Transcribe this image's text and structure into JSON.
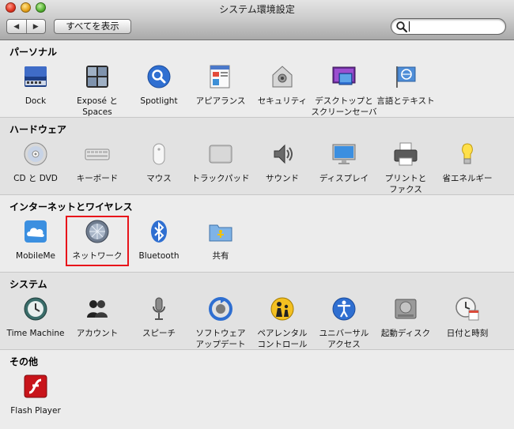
{
  "window": {
    "title": "システム環境設定"
  },
  "toolbar": {
    "back_glyph": "◀",
    "forward_glyph": "▶",
    "show_all_label": "すべてを表示",
    "search_value": "",
    "search_placeholder": ""
  },
  "colors": {
    "highlight": "#e8141a",
    "accent": "#2f6fd1"
  },
  "sections": [
    {
      "title": "パーソナル",
      "items": [
        {
          "label": "Dock",
          "icon": "dock-icon"
        },
        {
          "label": "Exposé と\nSpaces",
          "icon": "expose-spaces-icon"
        },
        {
          "label": "Spotlight",
          "icon": "spotlight-icon"
        },
        {
          "label": "アピアランス",
          "icon": "appearance-icon"
        },
        {
          "label": "セキュリティ",
          "icon": "security-icon"
        },
        {
          "label": "デスクトップと\nスクリーンセーバ",
          "icon": "desktop-screensaver-icon"
        },
        {
          "label": "言語とテキスト",
          "icon": "language-text-icon"
        }
      ]
    },
    {
      "title": "ハードウェア",
      "items": [
        {
          "label": "CD と DVD",
          "icon": "cd-dvd-icon"
        },
        {
          "label": "キーボード",
          "icon": "keyboard-icon"
        },
        {
          "label": "マウス",
          "icon": "mouse-icon"
        },
        {
          "label": "トラックパッド",
          "icon": "trackpad-icon"
        },
        {
          "label": "サウンド",
          "icon": "sound-icon"
        },
        {
          "label": "ディスプレイ",
          "icon": "display-icon"
        },
        {
          "label": "プリントと\nファクス",
          "icon": "print-fax-icon"
        },
        {
          "label": "省エネルギー",
          "icon": "energy-saver-icon"
        }
      ]
    },
    {
      "title": "インターネットとワイヤレス",
      "items": [
        {
          "label": "MobileMe",
          "icon": "mobileme-icon"
        },
        {
          "label": "ネットワーク",
          "icon": "network-icon"
        },
        {
          "label": "Bluetooth",
          "icon": "bluetooth-icon"
        },
        {
          "label": "共有",
          "icon": "sharing-icon"
        }
      ]
    },
    {
      "title": "システム",
      "items": [
        {
          "label": "Time Machine",
          "icon": "time-machine-icon"
        },
        {
          "label": "アカウント",
          "icon": "accounts-icon"
        },
        {
          "label": "スピーチ",
          "icon": "speech-icon"
        },
        {
          "label": "ソフトウェア\nアップデート",
          "icon": "software-update-icon"
        },
        {
          "label": "ペアレンタル\nコントロール",
          "icon": "parental-controls-icon"
        },
        {
          "label": "ユニバーサル\nアクセス",
          "icon": "universal-access-icon"
        },
        {
          "label": "起動ディスク",
          "icon": "startup-disk-icon"
        },
        {
          "label": "日付と時刻",
          "icon": "date-time-icon"
        }
      ]
    },
    {
      "title": "その他",
      "items": [
        {
          "label": "Flash Player",
          "icon": "flash-player-icon"
        }
      ]
    }
  ]
}
